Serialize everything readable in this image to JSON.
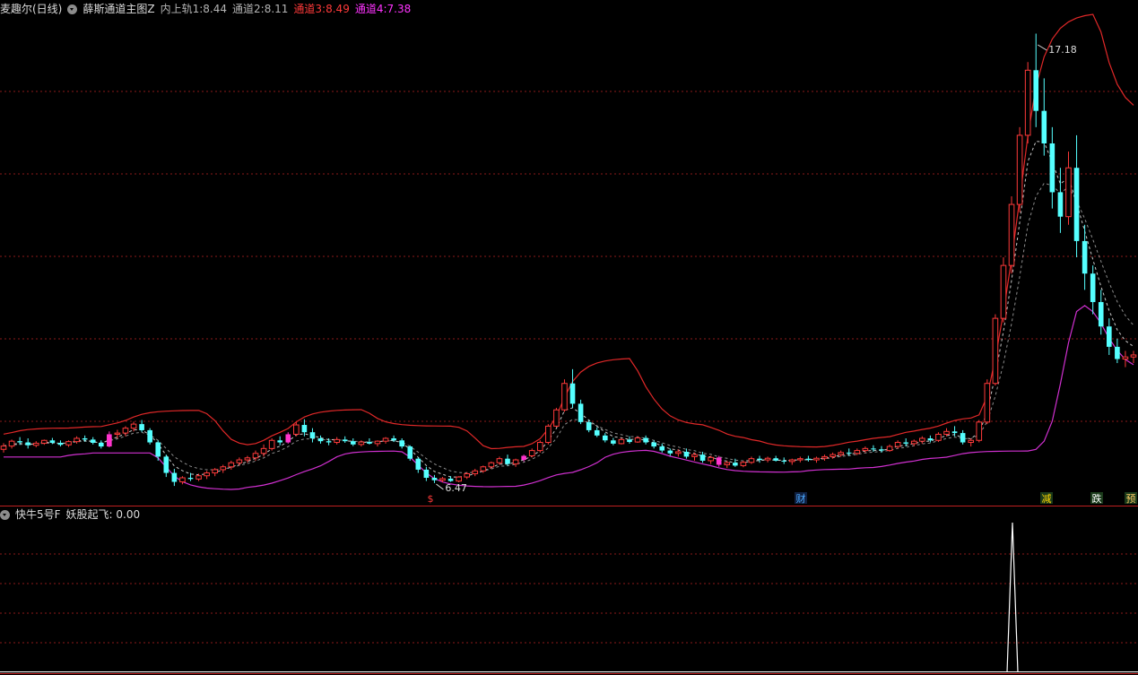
{
  "header": {
    "stock": "麦趣尔(日线)",
    "indicator": "薛斯通道主图Z",
    "values": [
      {
        "label": "内上轨1:",
        "value": "8.44",
        "color": "#b4b4b4"
      },
      {
        "label": "通道2:",
        "value": "8.11",
        "color": "#b4b4b4"
      },
      {
        "label": "通道3:",
        "value": "8.49",
        "color": "#ff3a3a"
      },
      {
        "label": "通道4:",
        "value": "7.38",
        "color": "#ff33ff"
      }
    ]
  },
  "sub_header": {
    "indicator": "快牛5号F",
    "label": "妖股起飞:",
    "value": "0.00"
  },
  "annotations": {
    "high_label": "17.18",
    "low_label": "6.47",
    "markers": [
      {
        "text": "$",
        "color": "#ff3a3a"
      },
      {
        "text": "财",
        "color": "#4aa8ff"
      },
      {
        "text": "减",
        "color": "#ffd700"
      },
      {
        "text": "跌",
        "color": "#ffffff"
      },
      {
        "text": "预",
        "color": "#ffcc66"
      }
    ]
  },
  "colors": {
    "up": "#ff3a3a",
    "down": "#55ffff",
    "mag_candle": "#ff33cc",
    "channel_upper": "#e02828",
    "channel_lower": "#d030d0",
    "mid_dashed": "#c8c8c8",
    "grid": "#8b1a1a",
    "separator": "#c02020"
  },
  "chart_data": [
    {
      "type": "candlestick",
      "title": "薛斯通道主图Z",
      "candles": [
        [
          7.28,
          7.43,
          7.2,
          7.36
        ],
        [
          7.36,
          7.52,
          7.3,
          7.48
        ],
        [
          7.48,
          7.58,
          7.39,
          7.45
        ],
        [
          7.45,
          7.55,
          7.3,
          7.38
        ],
        [
          7.38,
          7.48,
          7.33,
          7.43
        ],
        [
          7.43,
          7.52,
          7.39,
          7.5
        ],
        [
          7.5,
          7.56,
          7.41,
          7.44
        ],
        [
          7.44,
          7.5,
          7.35,
          7.39
        ],
        [
          7.39,
          7.5,
          7.34,
          7.47
        ],
        [
          7.47,
          7.6,
          7.42,
          7.55
        ],
        [
          7.55,
          7.62,
          7.47,
          7.52
        ],
        [
          7.52,
          7.58,
          7.4,
          7.44
        ],
        [
          7.44,
          7.5,
          7.3,
          7.35
        ],
        [
          7.35,
          7.72,
          7.33,
          7.65
        ],
        [
          7.65,
          7.76,
          7.55,
          7.68
        ],
        [
          7.68,
          7.85,
          7.6,
          7.8
        ],
        [
          7.8,
          7.96,
          7.72,
          7.9
        ],
        [
          7.9,
          8.0,
          7.7,
          7.75
        ],
        [
          7.75,
          7.8,
          7.4,
          7.45
        ],
        [
          7.45,
          7.5,
          7.0,
          7.1
        ],
        [
          7.1,
          7.15,
          6.6,
          6.7
        ],
        [
          6.7,
          6.8,
          6.38,
          6.48
        ],
        [
          6.48,
          6.62,
          6.42,
          6.58
        ],
        [
          6.58,
          6.7,
          6.5,
          6.55
        ],
        [
          6.55,
          6.68,
          6.5,
          6.63
        ],
        [
          6.63,
          6.75,
          6.55,
          6.7
        ],
        [
          6.7,
          6.82,
          6.62,
          6.78
        ],
        [
          6.78,
          6.9,
          6.7,
          6.85
        ],
        [
          6.85,
          7.0,
          6.78,
          6.95
        ],
        [
          6.95,
          7.08,
          6.88,
          7.02
        ],
        [
          7.02,
          7.12,
          6.95,
          7.07
        ],
        [
          7.07,
          7.25,
          7.0,
          7.18
        ],
        [
          7.18,
          7.4,
          7.1,
          7.3
        ],
        [
          7.3,
          7.55,
          7.25,
          7.5
        ],
        [
          7.5,
          7.6,
          7.38,
          7.45
        ],
        [
          7.45,
          7.7,
          7.42,
          7.65
        ],
        [
          7.65,
          7.95,
          7.6,
          7.88
        ],
        [
          7.88,
          8.02,
          7.6,
          7.7
        ],
        [
          7.7,
          7.8,
          7.45,
          7.55
        ],
        [
          7.55,
          7.62,
          7.42,
          7.48
        ],
        [
          7.48,
          7.55,
          7.38,
          7.45
        ],
        [
          7.45,
          7.58,
          7.4,
          7.52
        ],
        [
          7.52,
          7.6,
          7.44,
          7.48
        ],
        [
          7.48,
          7.55,
          7.36,
          7.4
        ],
        [
          7.4,
          7.5,
          7.35,
          7.46
        ],
        [
          7.46,
          7.55,
          7.4,
          7.42
        ],
        [
          7.42,
          7.5,
          7.35,
          7.48
        ],
        [
          7.48,
          7.58,
          7.42,
          7.55
        ],
        [
          7.55,
          7.62,
          7.46,
          7.5
        ],
        [
          7.5,
          7.55,
          7.3,
          7.35
        ],
        [
          7.35,
          7.38,
          7.0,
          7.05
        ],
        [
          7.05,
          7.08,
          6.7,
          6.78
        ],
        [
          6.78,
          6.85,
          6.5,
          6.58
        ],
        [
          6.58,
          6.65,
          6.45,
          6.52
        ],
        [
          6.52,
          6.6,
          6.47,
          6.56
        ],
        [
          6.56,
          6.62,
          6.48,
          6.5
        ],
        [
          6.5,
          6.62,
          6.47,
          6.6
        ],
        [
          6.6,
          6.72,
          6.55,
          6.68
        ],
        [
          6.68,
          6.8,
          6.62,
          6.75
        ],
        [
          6.75,
          6.88,
          6.7,
          6.85
        ],
        [
          6.85,
          6.98,
          6.8,
          6.95
        ],
        [
          6.95,
          7.1,
          6.9,
          7.05
        ],
        [
          7.05,
          7.15,
          6.88,
          6.92
        ],
        [
          6.92,
          7.05,
          6.85,
          7.02
        ],
        [
          7.02,
          7.15,
          6.98,
          7.12
        ],
        [
          7.12,
          7.3,
          7.08,
          7.25
        ],
        [
          7.25,
          7.5,
          7.2,
          7.45
        ],
        [
          7.45,
          7.9,
          7.4,
          7.85
        ],
        [
          7.85,
          8.3,
          7.82,
          8.25
        ],
        [
          8.25,
          9.0,
          8.2,
          8.9
        ],
        [
          8.9,
          9.25,
          8.3,
          8.4
        ],
        [
          8.4,
          8.5,
          7.9,
          7.95
        ],
        [
          7.95,
          8.0,
          7.7,
          7.75
        ],
        [
          7.75,
          7.82,
          7.58,
          7.62
        ],
        [
          7.62,
          7.68,
          7.45,
          7.5
        ],
        [
          7.5,
          7.56,
          7.38,
          7.42
        ],
        [
          7.42,
          7.56,
          7.4,
          7.52
        ],
        [
          7.52,
          7.6,
          7.42,
          7.46
        ],
        [
          7.46,
          7.6,
          7.44,
          7.56
        ],
        [
          7.56,
          7.62,
          7.4,
          7.45
        ],
        [
          7.45,
          7.5,
          7.3,
          7.35
        ],
        [
          7.35,
          7.42,
          7.2,
          7.25
        ],
        [
          7.25,
          7.3,
          7.12,
          7.18
        ],
        [
          7.18,
          7.28,
          7.1,
          7.22
        ],
        [
          7.22,
          7.3,
          7.05,
          7.1
        ],
        [
          7.1,
          7.2,
          7.0,
          7.15
        ],
        [
          7.15,
          7.22,
          6.95,
          7.0
        ],
        [
          7.0,
          7.12,
          6.92,
          7.08
        ],
        [
          7.08,
          7.12,
          6.85,
          6.9
        ],
        [
          6.9,
          7.0,
          6.82,
          6.95
        ],
        [
          6.95,
          7.05,
          6.85,
          6.88
        ],
        [
          6.88,
          7.0,
          6.84,
          6.96
        ],
        [
          6.96,
          7.1,
          6.92,
          7.05
        ],
        [
          7.05,
          7.12,
          6.95,
          7.02
        ],
        [
          7.02,
          7.1,
          6.96,
          7.06
        ],
        [
          7.06,
          7.12,
          6.98,
          7.0
        ],
        [
          7.0,
          7.08,
          6.92,
          6.98
        ],
        [
          6.98,
          7.05,
          6.9,
          7.02
        ],
        [
          7.02,
          7.1,
          6.96,
          7.05
        ],
        [
          7.05,
          7.12,
          6.98,
          7.02
        ],
        [
          7.02,
          7.1,
          6.95,
          7.06
        ],
        [
          7.06,
          7.15,
          7.0,
          7.1
        ],
        [
          7.1,
          7.2,
          7.05,
          7.15
        ],
        [
          7.15,
          7.25,
          7.1,
          7.2
        ],
        [
          7.2,
          7.3,
          7.12,
          7.18
        ],
        [
          7.18,
          7.3,
          7.14,
          7.25
        ],
        [
          7.25,
          7.35,
          7.2,
          7.3
        ],
        [
          7.3,
          7.38,
          7.22,
          7.28
        ],
        [
          7.28,
          7.36,
          7.2,
          7.25
        ],
        [
          7.25,
          7.4,
          7.22,
          7.35
        ],
        [
          7.35,
          7.5,
          7.3,
          7.45
        ],
        [
          7.45,
          7.55,
          7.35,
          7.42
        ],
        [
          7.42,
          7.52,
          7.36,
          7.48
        ],
        [
          7.48,
          7.6,
          7.42,
          7.55
        ],
        [
          7.55,
          7.62,
          7.45,
          7.5
        ],
        [
          7.5,
          7.7,
          7.46,
          7.65
        ],
        [
          7.65,
          7.8,
          7.6,
          7.72
        ],
        [
          7.72,
          7.85,
          7.6,
          7.68
        ],
        [
          7.68,
          7.75,
          7.4,
          7.45
        ],
        [
          7.45,
          7.55,
          7.35,
          7.5
        ],
        [
          7.5,
          8.0,
          7.45,
          7.95
        ],
        [
          7.95,
          9.0,
          7.9,
          8.9
        ],
        [
          8.9,
          10.6,
          8.85,
          10.5
        ],
        [
          10.5,
          12.0,
          10.4,
          11.8
        ],
        [
          11.8,
          13.5,
          11.6,
          13.3
        ],
        [
          13.3,
          15.2,
          13.1,
          15.0
        ],
        [
          15.0,
          16.8,
          14.8,
          16.6
        ],
        [
          16.6,
          17.5,
          15.2,
          15.6
        ],
        [
          15.6,
          16.4,
          14.5,
          14.8
        ],
        [
          14.8,
          15.2,
          13.2,
          13.6
        ],
        [
          13.6,
          14.2,
          12.6,
          13.0
        ],
        [
          13.0,
          14.6,
          12.8,
          14.2
        ],
        [
          14.2,
          15.0,
          12.0,
          12.4
        ],
        [
          12.4,
          12.8,
          11.2,
          11.6
        ],
        [
          11.6,
          11.8,
          10.6,
          10.9
        ],
        [
          10.9,
          11.2,
          10.1,
          10.3
        ],
        [
          10.3,
          10.5,
          9.6,
          9.8
        ],
        [
          9.8,
          10.0,
          9.4,
          9.5
        ],
        [
          9.5,
          9.7,
          9.3,
          9.55
        ],
        [
          9.55,
          9.7,
          9.4,
          9.6
        ]
      ],
      "annotations": {
        "high": "17.18",
        "low": "6.47"
      }
    },
    {
      "type": "line",
      "title": "快牛5号F",
      "series": [
        {
          "name": "妖股起飞",
          "values_note": "spike to 1 at index 126, otherwise 0"
        }
      ]
    }
  ]
}
